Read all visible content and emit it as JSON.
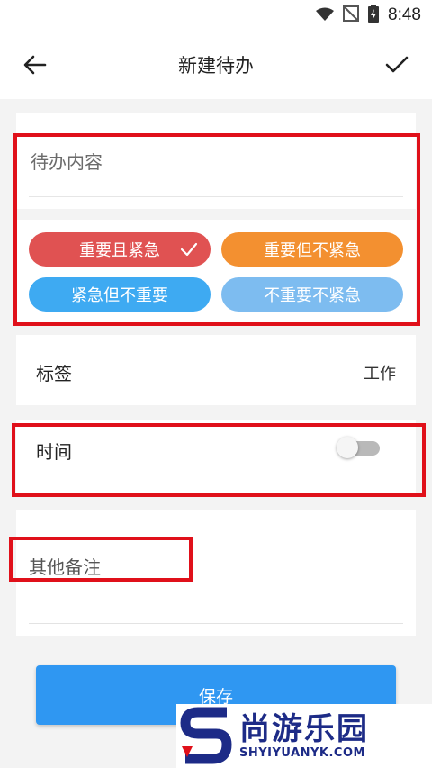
{
  "status_bar": {
    "time": "8:48"
  },
  "app_bar": {
    "title": "新建待办"
  },
  "todo": {
    "placeholder": "待办内容"
  },
  "priority": {
    "options": [
      {
        "label": "重要且紧急",
        "color": "#e05252",
        "selected": true
      },
      {
        "label": "重要但不紧急",
        "color": "#f39030",
        "selected": false
      },
      {
        "label": "紧急但不重要",
        "color": "#3eaaf2",
        "selected": false
      },
      {
        "label": "不重要不紧急",
        "color": "#7dbcf0",
        "selected": false
      }
    ]
  },
  "tag": {
    "label": "标签",
    "value": "工作"
  },
  "time": {
    "label": "时间",
    "enabled": false
  },
  "notes": {
    "placeholder": "其他备注"
  },
  "save": {
    "label": "保存"
  },
  "watermark": {
    "cn": "尚游乐园",
    "en": "SHYIYUANYK.COM"
  },
  "colors": {
    "accent": "#2f97f2",
    "highlight": "#e0101a"
  }
}
